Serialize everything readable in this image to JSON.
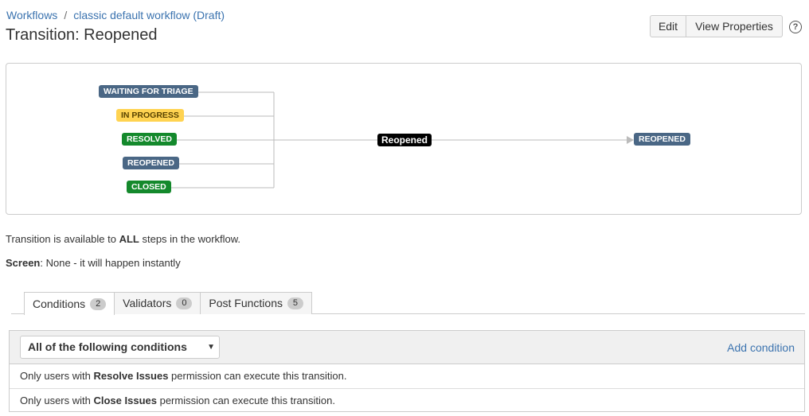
{
  "breadcrumb": {
    "workflows": "Workflows",
    "separator": "/",
    "workflow_name": "classic default workflow (Draft)"
  },
  "title": "Transition: Reopened",
  "actions": {
    "edit": "Edit",
    "view_properties": "View Properties",
    "help": "?"
  },
  "diagram": {
    "sources": [
      {
        "label": "WAITING FOR TRIAGE",
        "color": "#4a6785"
      },
      {
        "label": "IN PROGRESS",
        "color": "#ffd351"
      },
      {
        "label": "RESOLVED",
        "color": "#14892c"
      },
      {
        "label": "REOPENED",
        "color": "#4a6785"
      },
      {
        "label": "CLOSED",
        "color": "#14892c"
      }
    ],
    "transition": "Reopened",
    "target": {
      "label": "REOPENED",
      "color": "#4a6785"
    }
  },
  "info": {
    "availability_prefix": "Transition is available to ",
    "availability_strong": "ALL",
    "availability_suffix": " steps in the workflow.",
    "screen_label": "Screen",
    "screen_value": ": None - it will happen instantly"
  },
  "tabs": [
    {
      "label": "Conditions",
      "count": "2"
    },
    {
      "label": "Validators",
      "count": "0"
    },
    {
      "label": "Post Functions",
      "count": "5"
    }
  ],
  "conditions": {
    "select_value": "All of the following conditions",
    "add_label": "Add condition",
    "rows": [
      {
        "prefix": "Only users with ",
        "permission": "Resolve Issues",
        "suffix": " permission can execute this transition."
      },
      {
        "prefix": "Only users with ",
        "permission": "Close Issues",
        "suffix": " permission can execute this transition."
      }
    ]
  },
  "colors": {
    "link": "#3b73af",
    "status_blue": "#4a6785",
    "status_green": "#14892c",
    "status_yellow": "#ffd351"
  }
}
